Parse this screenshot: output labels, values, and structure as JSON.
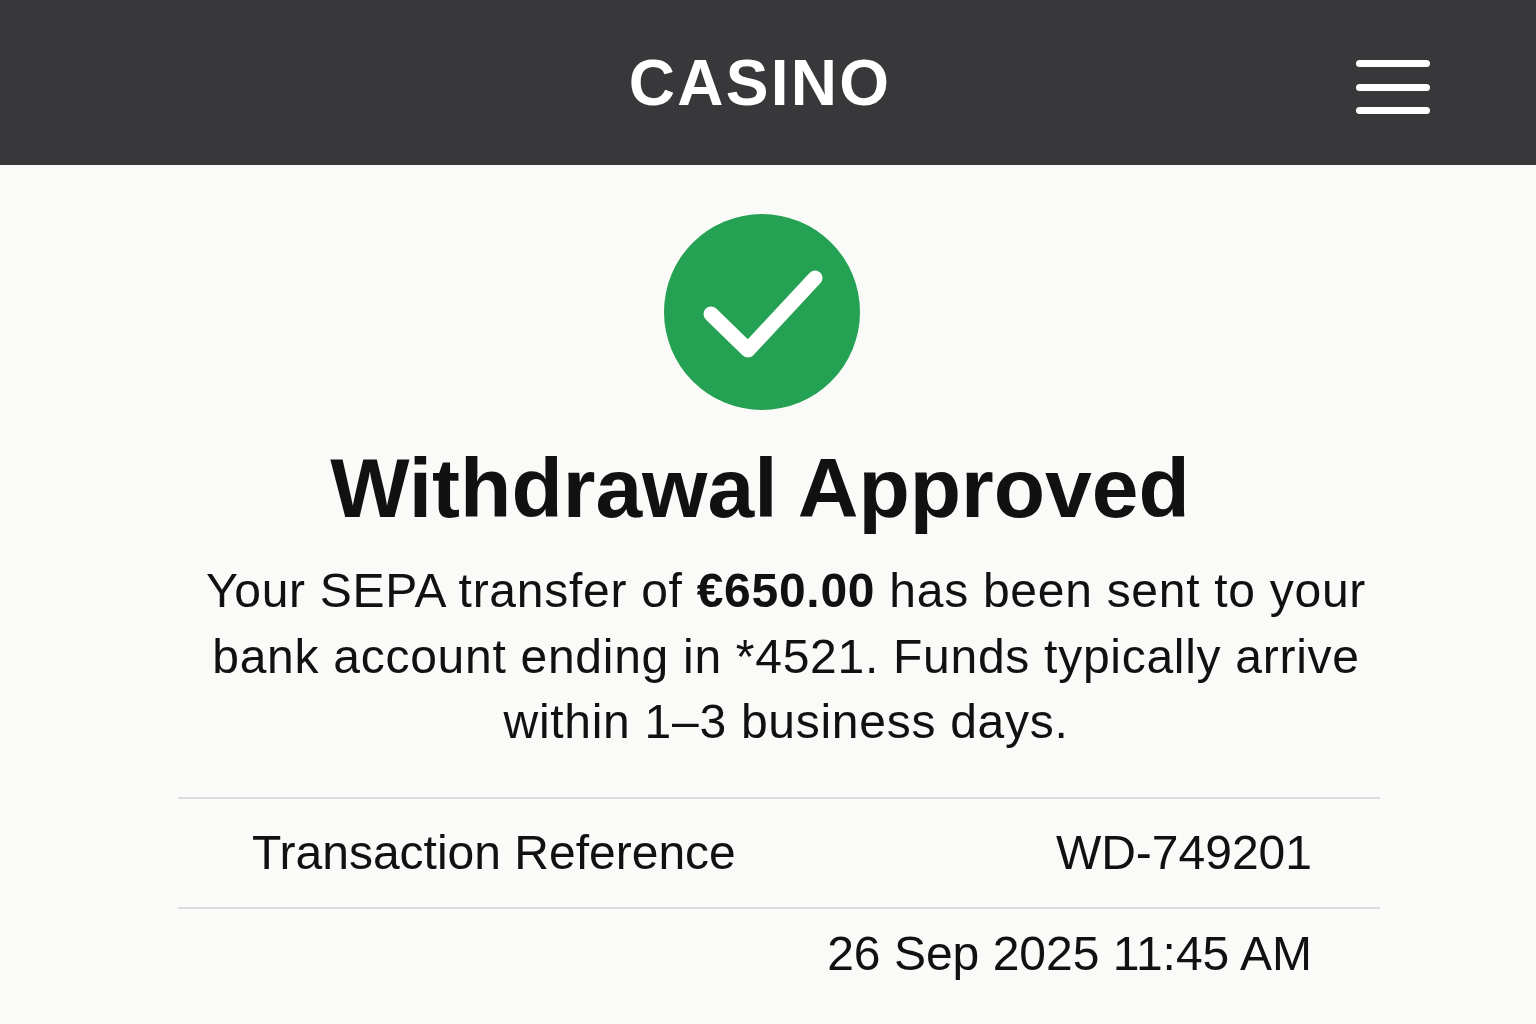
{
  "header": {
    "title": "CASINO"
  },
  "status": {
    "kind": "success",
    "title": "Withdrawal Approved",
    "message_lines": [
      "Your SEPA transfer of **€650.00** has been sent to your",
      "bank account ending in *4521. Funds typically arrive",
      "within 1–3 business days."
    ]
  },
  "details": [
    {
      "label": "Transaction Reference",
      "value": "WD-749201"
    },
    {
      "value": "26 Sep 2025 11:45 AM"
    }
  ]
}
